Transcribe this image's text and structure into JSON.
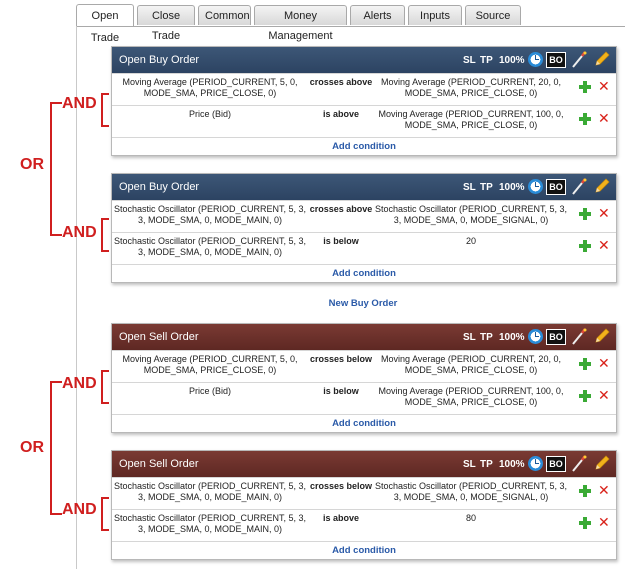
{
  "tabs": [
    {
      "label": "Open Trade",
      "active": true
    },
    {
      "label": "Close Trade",
      "active": false
    },
    {
      "label": "Common",
      "active": false
    },
    {
      "label": "Money Management",
      "active": false
    },
    {
      "label": "Alerts",
      "active": false
    },
    {
      "label": "Inputs",
      "active": false
    },
    {
      "label": "Source",
      "active": false
    }
  ],
  "header_controls": {
    "sl": "SL",
    "tp": "TP",
    "pct": "100%",
    "bo": "BO"
  },
  "logic": {
    "and": "AND",
    "or": "OR"
  },
  "colors": {
    "buy_header": "#2c4362",
    "sell_header": "#5e2823",
    "logic_red": "#d01f1f",
    "link_blue": "#2a5aa8",
    "add_green": "#3aaa35",
    "delete_red": "#d9221a"
  },
  "blocks": [
    {
      "title": "Open Buy Order",
      "type": "buy",
      "rows": [
        {
          "lhs": "Moving Average (PERIOD_CURRENT, 5, 0, MODE_SMA, PRICE_CLOSE, 0)",
          "op": "crosses above",
          "rhs": "Moving Average (PERIOD_CURRENT, 20, 0, MODE_SMA, PRICE_CLOSE, 0)"
        },
        {
          "lhs": "Price (Bid)",
          "op": "is above",
          "rhs": "Moving Average (PERIOD_CURRENT, 100, 0, MODE_SMA, PRICE_CLOSE, 0)"
        }
      ],
      "add_condition": "Add condition"
    },
    {
      "title": "Open Buy Order",
      "type": "buy",
      "rows": [
        {
          "lhs": "Stochastic Oscillator (PERIOD_CURRENT, 5, 3, 3, MODE_SMA, 0, MODE_MAIN, 0)",
          "op": "crosses above",
          "rhs": "Stochastic Oscillator (PERIOD_CURRENT, 5, 3, 3, MODE_SMA, 0, MODE_SIGNAL, 0)"
        },
        {
          "lhs": "Stochastic Oscillator (PERIOD_CURRENT, 5, 3, 3, MODE_SMA, 0, MODE_MAIN, 0)",
          "op": "is below",
          "rhs": "20"
        }
      ],
      "add_condition": "Add condition"
    },
    {
      "title": "Open Sell Order",
      "type": "sell",
      "rows": [
        {
          "lhs": "Moving Average (PERIOD_CURRENT, 5, 0, MODE_SMA, PRICE_CLOSE, 0)",
          "op": "crosses below",
          "rhs": "Moving Average (PERIOD_CURRENT, 20, 0, MODE_SMA, PRICE_CLOSE, 0)"
        },
        {
          "lhs": "Price (Bid)",
          "op": "is below",
          "rhs": "Moving Average (PERIOD_CURRENT, 100, 0, MODE_SMA, PRICE_CLOSE, 0)"
        }
      ],
      "add_condition": "Add condition"
    },
    {
      "title": "Open Sell Order",
      "type": "sell",
      "rows": [
        {
          "lhs": "Stochastic Oscillator (PERIOD_CURRENT, 5, 3, 3, MODE_SMA, 0, MODE_MAIN, 0)",
          "op": "crosses below",
          "rhs": "Stochastic Oscillator (PERIOD_CURRENT, 5, 3, 3, MODE_SMA, 0, MODE_SIGNAL, 0)"
        },
        {
          "lhs": "Stochastic Oscillator (PERIOD_CURRENT, 5, 3, 3, MODE_SMA, 0, MODE_MAIN, 0)",
          "op": "is above",
          "rhs": "80"
        }
      ],
      "add_condition": "Add condition"
    }
  ],
  "new_buy_order": "New Buy Order"
}
